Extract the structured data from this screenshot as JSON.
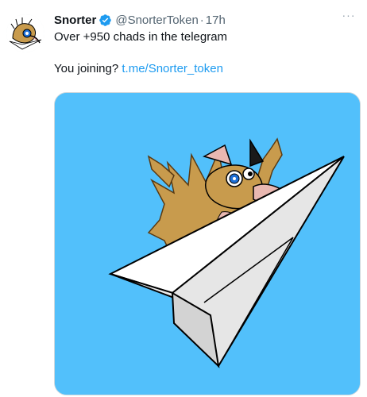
{
  "author": {
    "name": "Snorter",
    "handle": "@SnorterToken",
    "separator": "·",
    "time": "17h",
    "verified": true,
    "avatar_icon": "aardvark-mascot-icon"
  },
  "tweet": {
    "text_line1": "Over +950  chads in the telegram",
    "text_line2_prefix": "You joining?",
    "link_text": "t.me/Snorter_token"
  },
  "media": {
    "description_icon": "aardvark-on-paper-plane-icon",
    "background_color": "#52c0fb"
  },
  "more_icon": "more-dots-icon",
  "colors": {
    "link": "#1d9bf0",
    "verified_badge": "#1d9bf0",
    "muted": "#536471"
  }
}
